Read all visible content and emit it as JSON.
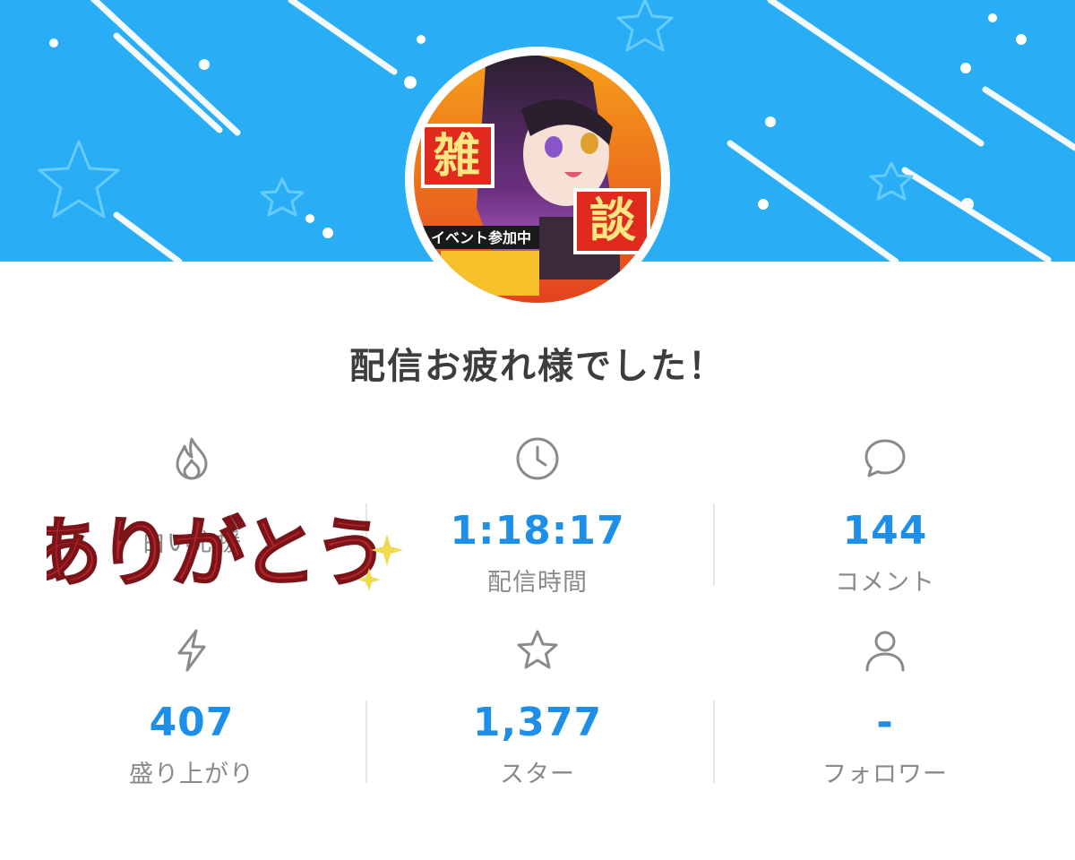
{
  "header": {
    "banner_color": "#29aef5",
    "avatar": {
      "alt": "ストリーマーのアバター",
      "badge_text": [
        "雑",
        "談"
      ],
      "event_text": "イベント参加中"
    }
  },
  "title": "配信お疲れ様でした！",
  "stats": [
    {
      "id": "support",
      "icon": "fire-icon",
      "value": "",
      "label": "白い応援"
    },
    {
      "id": "duration",
      "icon": "clock-icon",
      "value": "1:18:17",
      "label": "配信時間"
    },
    {
      "id": "comments",
      "icon": "speech-bubble-icon",
      "value": "144",
      "label": "コメント"
    },
    {
      "id": "excitement",
      "icon": "lightning-icon",
      "value": "407",
      "label": "盛り上がり"
    },
    {
      "id": "stars",
      "icon": "star-icon",
      "value": "1,377",
      "label": "スター"
    },
    {
      "id": "followers",
      "icon": "person-icon",
      "value": "-",
      "label": "フォロワー"
    }
  ],
  "sticker": {
    "text": "ありがとう",
    "color": "#b3232a"
  },
  "colors": {
    "value": "#1d8fe8",
    "label": "#8a8a8a",
    "title": "#3d3d3d"
  }
}
